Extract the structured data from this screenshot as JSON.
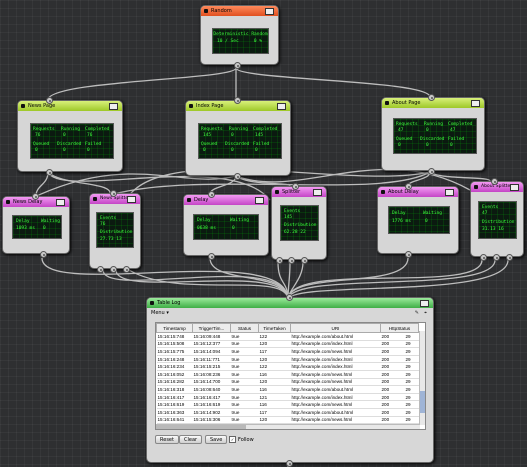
{
  "colors": {
    "accent_green": "#9ec828",
    "accent_purple": "#c445c6",
    "accent_red": "#e0501f",
    "screen_text": "#3dff3d"
  },
  "random": {
    "title": "Random",
    "screen": [
      "Deterministic Random",
      "10 / Sec",
      "0 %"
    ]
  },
  "news_page": {
    "title": "News Page",
    "row1": [
      "Requests",
      "Running",
      "Completed"
    ],
    "row1v": [
      "76",
      "0",
      "76"
    ],
    "row2": [
      "Queued",
      "Discarded",
      "Failed"
    ],
    "row2v": [
      "0",
      "0",
      "0"
    ]
  },
  "index_page": {
    "title": "Index Page",
    "row1": [
      "Requests",
      "Running",
      "Completed"
    ],
    "row1v": [
      "145",
      "0",
      "145"
    ],
    "row2": [
      "Queued",
      "Discarded",
      "Failed"
    ],
    "row2v": [
      "0",
      "0",
      "0"
    ]
  },
  "about_page": {
    "title": "About Page",
    "row1": [
      "Requests",
      "Running",
      "Completed"
    ],
    "row1v": [
      "47",
      "0",
      "47"
    ],
    "row2": [
      "Queued",
      "Discarded",
      "Failed"
    ],
    "row2v": [
      "0",
      "0",
      "0"
    ]
  },
  "news_delay": {
    "title": "News Delay",
    "l1": [
      "Delay",
      "Waiting"
    ],
    "v1": [
      "1093 ms",
      "0"
    ]
  },
  "news_splitter": {
    "title": "News Splitter",
    "l1": "Events",
    "v1": "76",
    "l2": "Distribution",
    "v2": "27.73 13"
  },
  "delay": {
    "title": "Delay",
    "l1": [
      "Delay",
      "Waiting"
    ],
    "v1": [
      "0638 ms",
      "0"
    ]
  },
  "splitter": {
    "title": "Splitter",
    "l1": "Events",
    "v1": "145",
    "l2": "Distribution",
    "v2": "62.28 22"
  },
  "about_delay": {
    "title": "About Delay",
    "l1": [
      "Delay",
      "Waiting"
    ],
    "v1": [
      "1776 ms",
      "0"
    ]
  },
  "about_splitter": {
    "title": "About Splitter",
    "l1": "Events",
    "v1": "47",
    "l2": "Distribution",
    "v2": "31.13 16"
  },
  "table_log": {
    "title": "Table Log",
    "menu": "Menu ▾",
    "columns": [
      "Timestamp",
      "TriggerTim...",
      "Status",
      "TimeTaken",
      "URI",
      "HttpStatus"
    ],
    "rows": [
      [
        "15:16:15:748",
        "15:16:09:448",
        "true",
        "122",
        "http://example.com/about.html",
        "200",
        "29"
      ],
      [
        "15:16:15:508",
        "15:16:12:377",
        "true",
        "120",
        "http://example.com/index.html",
        "200",
        "29"
      ],
      [
        "15:16:15:775",
        "15:16:14:094",
        "true",
        "117",
        "http://example.com/news.html",
        "200",
        "29"
      ],
      [
        "15:16:16:248",
        "15:16:11:771",
        "true",
        "120",
        "http://example.com/index.html",
        "200",
        "29"
      ],
      [
        "15:16:16:234",
        "15:16:15:215",
        "true",
        "122",
        "http://example.com/index.html",
        "200",
        "29"
      ],
      [
        "15:16:16:052",
        "15:16:08:236",
        "true",
        "116",
        "http://example.com/news.html",
        "200",
        "29"
      ],
      [
        "15:16:16:282",
        "15:16:14:700",
        "true",
        "120",
        "http://example.com/news.html",
        "200",
        "29"
      ],
      [
        "15:16:16:318",
        "15:16:08:640",
        "true",
        "116",
        "http://example.com/about.html",
        "200",
        "29"
      ],
      [
        "15:16:16:417",
        "15:16:16:417",
        "true",
        "121",
        "http://example.com/index.html",
        "200",
        "29"
      ],
      [
        "15:16:16:619",
        "15:16:16:619",
        "true",
        "116",
        "http://example.com/news.html",
        "200",
        "29"
      ],
      [
        "15:16:16:363",
        "15:16:14:902",
        "true",
        "117",
        "http://example.com/about.html",
        "200",
        "29"
      ],
      [
        "15:16:16:641",
        "15:16:15:306",
        "true",
        "120",
        "http://example.com/news.html",
        "200",
        "29"
      ]
    ],
    "buttons": {
      "reset": "Reset",
      "clear": "Clear",
      "save": "Save"
    },
    "follow": "Follow",
    "follow_mark": "✓"
  }
}
